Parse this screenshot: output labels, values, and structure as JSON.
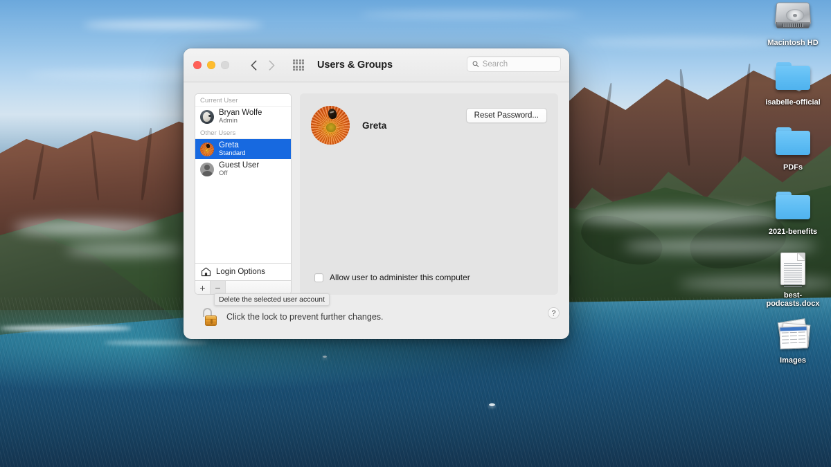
{
  "desktop": {
    "icons": [
      {
        "label": "Macintosh HD",
        "kind": "hard-drive"
      },
      {
        "label": "isabelle-official",
        "kind": "folder"
      },
      {
        "label": "PDFs",
        "kind": "folder"
      },
      {
        "label": "2021-benefits",
        "kind": "folder"
      },
      {
        "label": "best-\npodcasts.docx",
        "kind": "document"
      },
      {
        "label": "Images",
        "kind": "image-stack"
      }
    ]
  },
  "window": {
    "title": "Users & Groups",
    "traffic": {
      "close": "close",
      "minimize": "minimize",
      "zoom": "zoom-disabled"
    },
    "nav": {
      "back": "back",
      "forward": "forward"
    },
    "show_all": "show-all-grid",
    "search": {
      "value": "",
      "placeholder": "Search"
    }
  },
  "sidebar": {
    "groups": [
      {
        "header": "Current User",
        "users": [
          {
            "name": "Bryan Wolfe",
            "role": "Admin",
            "avatar": "bryan",
            "selected": false
          }
        ]
      },
      {
        "header": "Other Users",
        "users": [
          {
            "name": "Greta",
            "role": "Standard",
            "avatar": "greta",
            "selected": true
          },
          {
            "name": "Guest User",
            "role": "Off",
            "avatar": "guest",
            "selected": false
          }
        ]
      }
    ],
    "login_options": "Login Options",
    "add_label": "+",
    "remove_label": "−"
  },
  "content": {
    "account_name": "Greta",
    "reset_password": "Reset Password...",
    "admin_checkbox": {
      "label": "Allow user to administer this computer",
      "checked": false
    }
  },
  "footer": {
    "lock_text": "Click the lock to prevent further changes.",
    "lock_state": "unlocked",
    "tooltip": "Delete the selected user account",
    "help": "?"
  }
}
